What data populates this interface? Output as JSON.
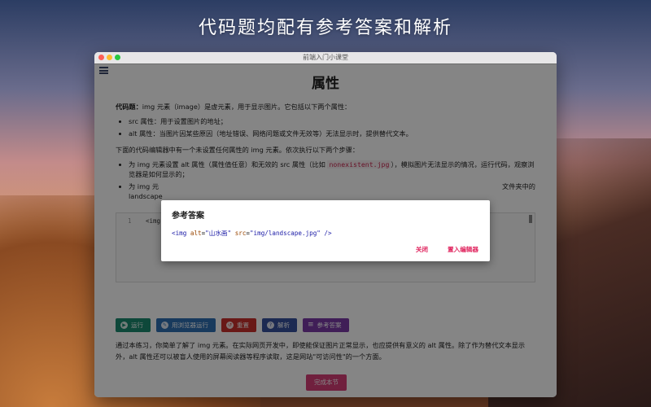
{
  "headline": "代码题均配有参考答案和解析",
  "window": {
    "title": "前端入门小课堂"
  },
  "lesson": {
    "title": "属性",
    "intro_label": "代码题：",
    "intro_text": "img 元素（image）是虚元素，用于显示图片。它包括以下两个属性：",
    "attrs": [
      "src 属性：用于设置图片的地址；",
      "alt 属性：当图片因某些原因（地址错误、网络问题或文件无效等）无法显示时，提供替代文本。"
    ],
    "steps_intro": "下面的代码编辑器中有一个未设置任何属性的 img 元素。依次执行以下两个步骤：",
    "step1_prefix": "为 img 元素设置 alt 属性（属性值任意）和无效的 src 属性（比如 ",
    "step1_code": "nonexistent.jpg",
    "step1_suffix": "），模拟图片无法显示的情况，运行代码，观察浏览器是如何显示的；",
    "step2_start": "为 img 元",
    "step2_end": "文件夹中的",
    "step2_line2": "landscape"
  },
  "editor": {
    "line_number": "1",
    "line_text": "<img"
  },
  "buttons": {
    "run": "运行",
    "browser": "用浏览器运行",
    "reset": "重置",
    "explain": "解析",
    "answer": "参考答案"
  },
  "summary": "通过本练习，你简单了解了 img 元素。在实际网页开发中，即使能保证图片正常显示，也应提供有意义的 alt 属性。除了作为替代文本显示外，alt 属性还可以被盲人使用的屏幕阅读器等程序读取，这是网站\"可访问性\"的一个方面。",
  "finish": "完成本节",
  "modal": {
    "title": "参考答案",
    "code": {
      "open": "<img",
      "attr1": "alt",
      "val1": "\"山水画\"",
      "attr2": "src",
      "val2": "\"img/landscape.jpg\"",
      "close": " />"
    },
    "close_label": "关闭",
    "insert_label": "置入编辑器"
  }
}
